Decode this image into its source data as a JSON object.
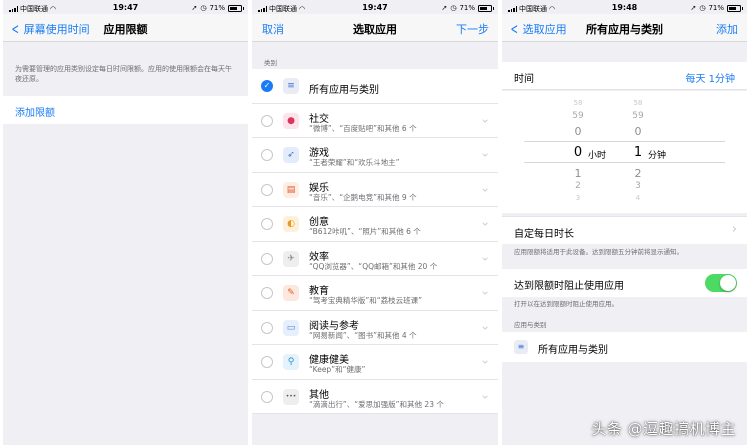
{
  "status": {
    "carrier": "中国联通",
    "battery": "71%",
    "battery_level": 0.71
  },
  "screen1": {
    "time": "19:47",
    "back_label": "屏幕使用时间",
    "title": "应用限额",
    "footnote": "为需要管理的应用类别设定每日时间限额。应用的使用限额会在每天午夜还原。",
    "add_limit": "添加限额"
  },
  "screen2": {
    "time": "19:47",
    "cancel": "取消",
    "title": "选取应用",
    "next": "下一步",
    "section": "类别",
    "items": [
      {
        "title": "所有应用与类别",
        "sub": "",
        "checked": true,
        "icon": "stack-icon"
      },
      {
        "title": "社交",
        "sub": "“微博”、“百度贴吧”和其他 6 个",
        "checked": false,
        "icon": "chat-bubble-icon"
      },
      {
        "title": "游戏",
        "sub": "“王者荣耀”和“欢乐斗地主”",
        "checked": false,
        "icon": "rocket-icon"
      },
      {
        "title": "娱乐",
        "sub": "“音乐”、“企鹅电竞”和其他 9 个",
        "checked": false,
        "icon": "popcorn-icon"
      },
      {
        "title": "创意",
        "sub": "“B612咔叽”、“照片”和其他 6 个",
        "checked": false,
        "icon": "palette-icon"
      },
      {
        "title": "效率",
        "sub": "“QQ浏览器”、“QQ邮箱”和其他 20 个",
        "checked": false,
        "icon": "paper-plane-icon"
      },
      {
        "title": "教育",
        "sub": "“驾考宝典精华版”和“荔枝云班课”",
        "checked": false,
        "icon": "brush-icon"
      },
      {
        "title": "阅读与参考",
        "sub": "“网易新闻”、“图书”和其他 4 个",
        "checked": false,
        "icon": "book-icon"
      },
      {
        "title": "健康健美",
        "sub": "“Keep”和“健康”",
        "checked": false,
        "icon": "bicycle-icon"
      },
      {
        "title": "其他",
        "sub": "“滴滴出行”、“爱思加强版”和其他 23 个",
        "checked": false,
        "icon": "ellipsis-icon"
      }
    ]
  },
  "screen3": {
    "time": "19:48",
    "back_label": "选取应用",
    "title": "所有应用与类别",
    "add": "添加",
    "time_label": "时间",
    "time_value": "每天 1分钟",
    "picker": {
      "hours_above": [
        "58",
        "59",
        "0"
      ],
      "hours_selected": "0",
      "hours_unit": "小时",
      "hours_below": [
        "1",
        "2",
        "3"
      ],
      "minutes_above": [
        "58",
        "59",
        "0"
      ],
      "minutes_selected": "1",
      "minutes_unit": "分钟",
      "minutes_below": [
        "2",
        "3",
        "4"
      ]
    },
    "custom_daily": "自定每日时长",
    "custom_note": "应用限额将适用于此设备。达到限额五分钟前将显示通知。",
    "block_label": "达到限额时阻止使用应用",
    "block_note": "打开以在达到限额时阻止使用应用。",
    "block_on": true,
    "apps_section": "应用与类别",
    "apps_item": "所有应用与类别"
  },
  "watermark": "头条 @逗趣搞机博主",
  "colors": {
    "accent": "#1a7cf5",
    "toggle_on": "#4cd964",
    "bg": "#efeff4"
  }
}
